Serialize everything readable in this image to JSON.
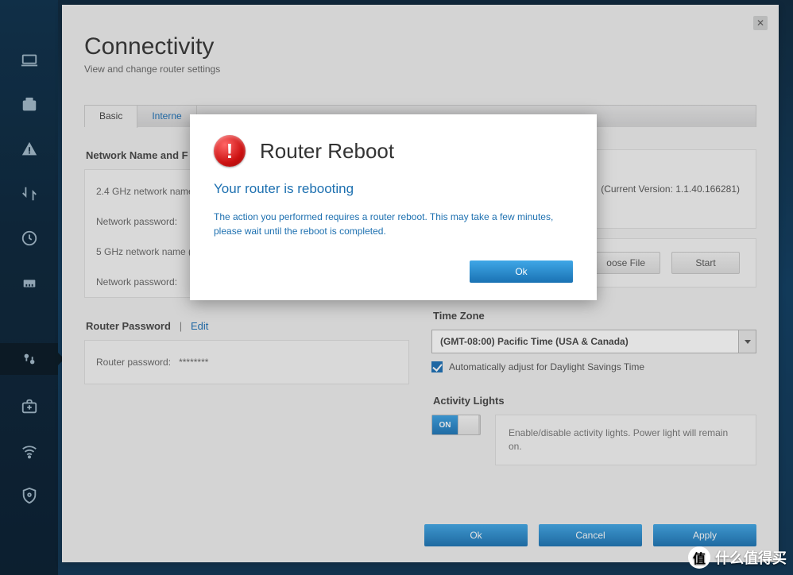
{
  "sidebar": {
    "items": [
      {
        "name": "laptop-icon"
      },
      {
        "name": "dashboard-icon"
      },
      {
        "name": "alert-icon"
      },
      {
        "name": "transfer-icon"
      },
      {
        "name": "clock-icon"
      },
      {
        "name": "ethernet-icon"
      }
    ],
    "tools": [
      {
        "name": "settings-icon",
        "active": true
      },
      {
        "name": "first-aid-icon"
      },
      {
        "name": "wifi-icon"
      },
      {
        "name": "security-shield-icon"
      }
    ]
  },
  "page": {
    "title": "Connectivity",
    "subtitle": "View and change router settings"
  },
  "tabs": [
    {
      "label": "Basic",
      "active": true
    },
    {
      "label": "Interne"
    }
  ],
  "network_section": {
    "title_fragment": "Network Name and F",
    "rows": {
      "ssid24_label": "2.4 GHz network name (",
      "pwd1_label": "Network password:",
      "ssid5_label": "5 GHz network name (S",
      "pwd2_label": "Network password:"
    }
  },
  "router_password": {
    "title": "Router Password",
    "sep": "|",
    "edit": "Edit",
    "label": "Router password:",
    "value": "********"
  },
  "firmware": {
    "version_prefix": "(Current Version: ",
    "version": "1.1.40.166281",
    "version_suffix": ")",
    "choose_btn_fragment": "oose File",
    "start_btn": "Start"
  },
  "timezone_section": {
    "title": "Time Zone",
    "value": "(GMT-08:00) Pacific Time (USA & Canada)",
    "dst_label": "Automatically adjust for Daylight Savings Time",
    "dst_checked": true
  },
  "activity_section": {
    "title": "Activity Lights",
    "toggle_label": "ON",
    "description": "Enable/disable activity lights. Power light will remain on."
  },
  "bottom_buttons": {
    "ok": "Ok",
    "cancel": "Cancel",
    "apply": "Apply"
  },
  "modal": {
    "title": "Router Reboot",
    "subtitle": "Your router is rebooting",
    "body": "The action you performed requires a router reboot. This may take a few minutes, please wait until the reboot is completed.",
    "ok": "Ok"
  },
  "watermark": {
    "logo_char": "值",
    "text": "什么值得买"
  }
}
